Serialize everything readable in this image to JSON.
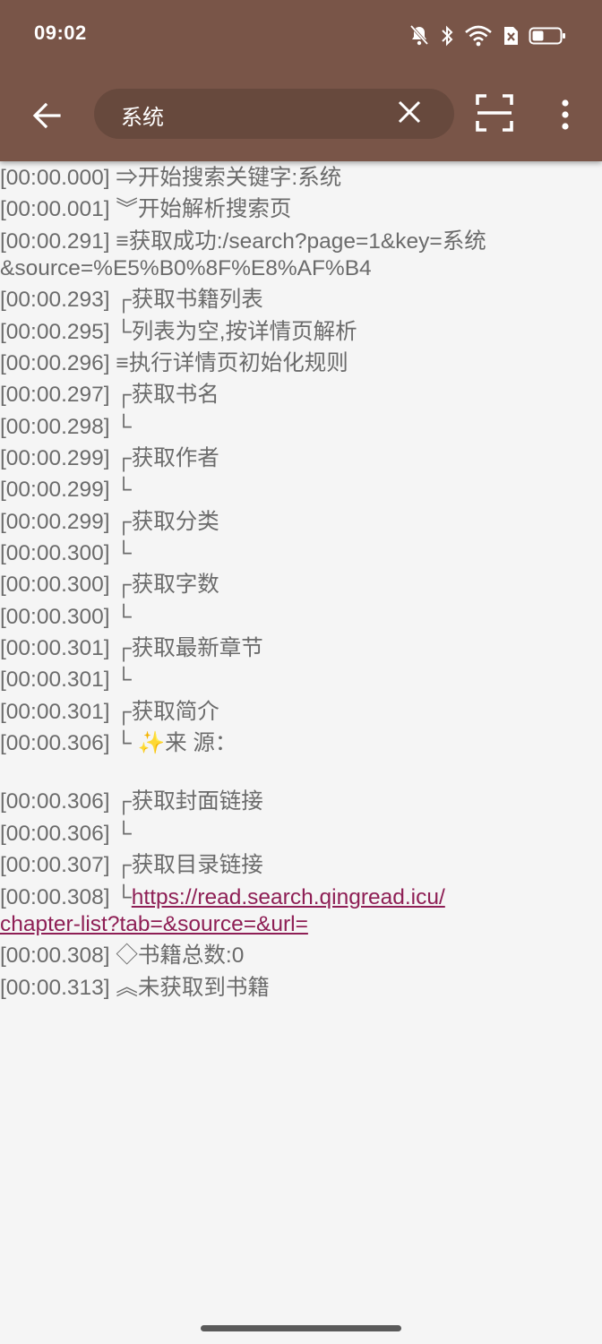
{
  "status_bar": {
    "time": "09:02",
    "icons": [
      "bell-off-icon",
      "bluetooth-icon",
      "wifi-icon",
      "sim-blocked-icon",
      "battery-icon"
    ]
  },
  "toolbar": {
    "search_value": "系统",
    "icons": [
      "back-arrow-icon",
      "clear-icon",
      "scan-icon",
      "more-vert-icon"
    ]
  },
  "colors": {
    "appbar": "#795548",
    "background": "#f5f5f5",
    "log_text": "#6b6b6b",
    "link": "#8e1f55"
  },
  "log": [
    {
      "time": "[00:00.000]",
      "text": "⇒开始搜索关键字:系统"
    },
    {
      "time": "[00:00.001]",
      "text": "︾开始解析搜索页"
    },
    {
      "time": "[00:00.291]",
      "text": "≡获取成功:/search?page=1&key=系统"
    },
    {
      "time": "",
      "text": "&source=%E5%B0%8F%E8%AF%B4"
    },
    {
      "time": "[00:00.293]",
      "text": "┌获取书籍列表"
    },
    {
      "time": "[00:00.295]",
      "text": "└列表为空,按详情页解析"
    },
    {
      "time": "[00:00.296]",
      "text": "≡执行详情页初始化规则"
    },
    {
      "time": "[00:00.297]",
      "text": "┌获取书名"
    },
    {
      "time": "[00:00.298]",
      "text": "└"
    },
    {
      "time": "[00:00.299]",
      "text": "┌获取作者"
    },
    {
      "time": "[00:00.299]",
      "text": "└"
    },
    {
      "time": "[00:00.299]",
      "text": "┌获取分类"
    },
    {
      "time": "[00:00.300]",
      "text": "└"
    },
    {
      "time": "[00:00.300]",
      "text": "┌获取字数"
    },
    {
      "time": "[00:00.300]",
      "text": "└"
    },
    {
      "time": "[00:00.301]",
      "text": "┌获取最新章节"
    },
    {
      "time": "[00:00.301]",
      "text": "└"
    },
    {
      "time": "[00:00.301]",
      "text": "┌获取简介"
    },
    {
      "time": "[00:00.306]",
      "text": "└        ✨来 源："
    },
    {
      "time": "[00:00.306]",
      "text": "┌获取封面链接"
    },
    {
      "time": "[00:00.306]",
      "text": "└"
    },
    {
      "time": "[00:00.307]",
      "text": "┌获取目录链接"
    },
    {
      "time": "[00:00.308]",
      "text": "└",
      "link": "https://read.search.qingread.icu/"
    },
    {
      "time": "",
      "text": "",
      "link": "chapter-list?tab=&source=&url="
    },
    {
      "time": "[00:00.308]",
      "text": "◇书籍总数:0"
    },
    {
      "time": "[00:00.313]",
      "text": "︽未获取到书籍"
    }
  ]
}
